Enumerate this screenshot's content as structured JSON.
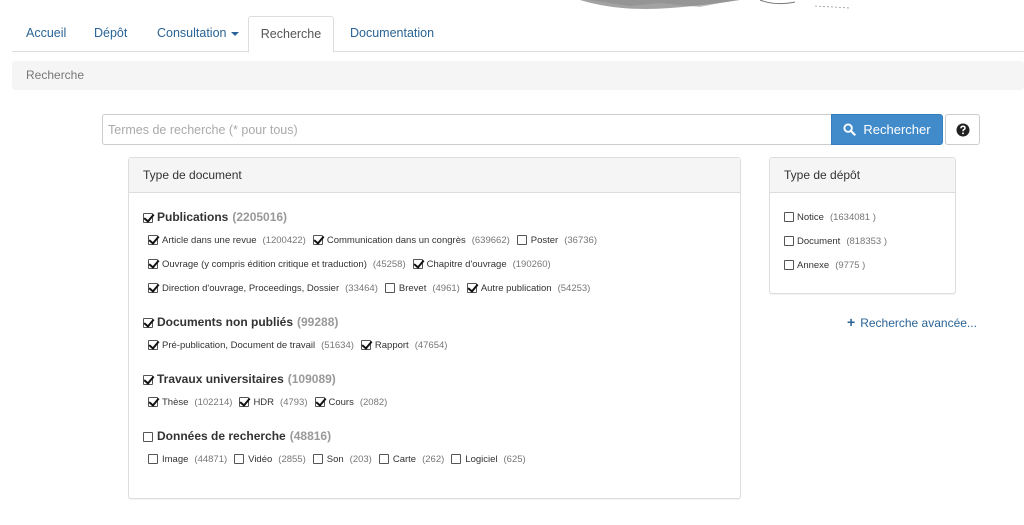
{
  "nav": {
    "tabs": [
      {
        "label": "Accueil"
      },
      {
        "label": "Dépôt"
      },
      {
        "label": "Consultation"
      },
      {
        "label": "Recherche"
      },
      {
        "label": "Documentation"
      }
    ],
    "active_tab": "Recherche"
  },
  "breadcrumb": {
    "label": "Recherche"
  },
  "search": {
    "placeholder": "Termes de recherche (* pour tous)",
    "value": "",
    "button_label": "Rechercher"
  },
  "doc_panel": {
    "title": "Type de document",
    "groups": [
      {
        "label": "Publications",
        "count": "(2205016)",
        "checked": true,
        "lines": [
          [
            {
              "label": "Article dans une revue",
              "count": "(1200422)",
              "checked": true
            },
            {
              "label": "Communication dans un congrès",
              "count": "(639662)",
              "checked": true
            },
            {
              "label": "Poster",
              "count": "(36736)",
              "checked": false
            }
          ],
          [
            {
              "label": "Ouvrage (y compris édition critique et traduction)",
              "count": "(45258)",
              "checked": true
            },
            {
              "label": "Chapitre d'ouvrage",
              "count": "(190260)",
              "checked": true
            }
          ],
          [
            {
              "label": "Direction d'ouvrage, Proceedings, Dossier",
              "count": "(33464)",
              "checked": true
            },
            {
              "label": "Brevet",
              "count": "(4961)",
              "checked": false
            },
            {
              "label": "Autre publication",
              "count": "(54253)",
              "checked": true
            }
          ]
        ]
      },
      {
        "label": "Documents non publiés",
        "count": "(99288)",
        "checked": true,
        "lines": [
          [
            {
              "label": "Pré-publication, Document de travail",
              "count": "(51634)",
              "checked": true
            },
            {
              "label": "Rapport",
              "count": "(47654)",
              "checked": true
            }
          ]
        ]
      },
      {
        "label": "Travaux universitaires",
        "count": "(109089)",
        "checked": true,
        "lines": [
          [
            {
              "label": "Thèse",
              "count": "(102214)",
              "checked": true
            },
            {
              "label": "HDR",
              "count": "(4793)",
              "checked": true
            },
            {
              "label": "Cours",
              "count": "(2082)",
              "checked": true
            }
          ]
        ]
      },
      {
        "label": "Données de recherche",
        "count": "(48816)",
        "checked": false,
        "lines": [
          [
            {
              "label": "Image",
              "count": "(44871)",
              "checked": false
            },
            {
              "label": "Vidéo",
              "count": "(2855)",
              "checked": false
            },
            {
              "label": "Son",
              "count": "(203)",
              "checked": false
            },
            {
              "label": "Carte",
              "count": "(262)",
              "checked": false
            },
            {
              "label": "Logiciel",
              "count": "(625)",
              "checked": false
            }
          ]
        ]
      }
    ]
  },
  "deposit_panel": {
    "title": "Type de dépôt",
    "items": [
      {
        "label": "Notice",
        "count": "(1634081 )",
        "checked": false
      },
      {
        "label": "Document",
        "count": "(818353 )",
        "checked": false
      },
      {
        "label": "Annexe",
        "count": "(9775 )",
        "checked": false
      }
    ]
  },
  "advanced_link": {
    "label": "Recherche avancée..."
  },
  "icons": {
    "search": "search-icon",
    "help": "question-circle-icon",
    "plus": "plus-icon",
    "dropdown": "caret-down-icon"
  },
  "colors": {
    "link": "#2a6496",
    "primary_button": "#428bca",
    "breadcrumb_bg": "#f5f5f5"
  }
}
